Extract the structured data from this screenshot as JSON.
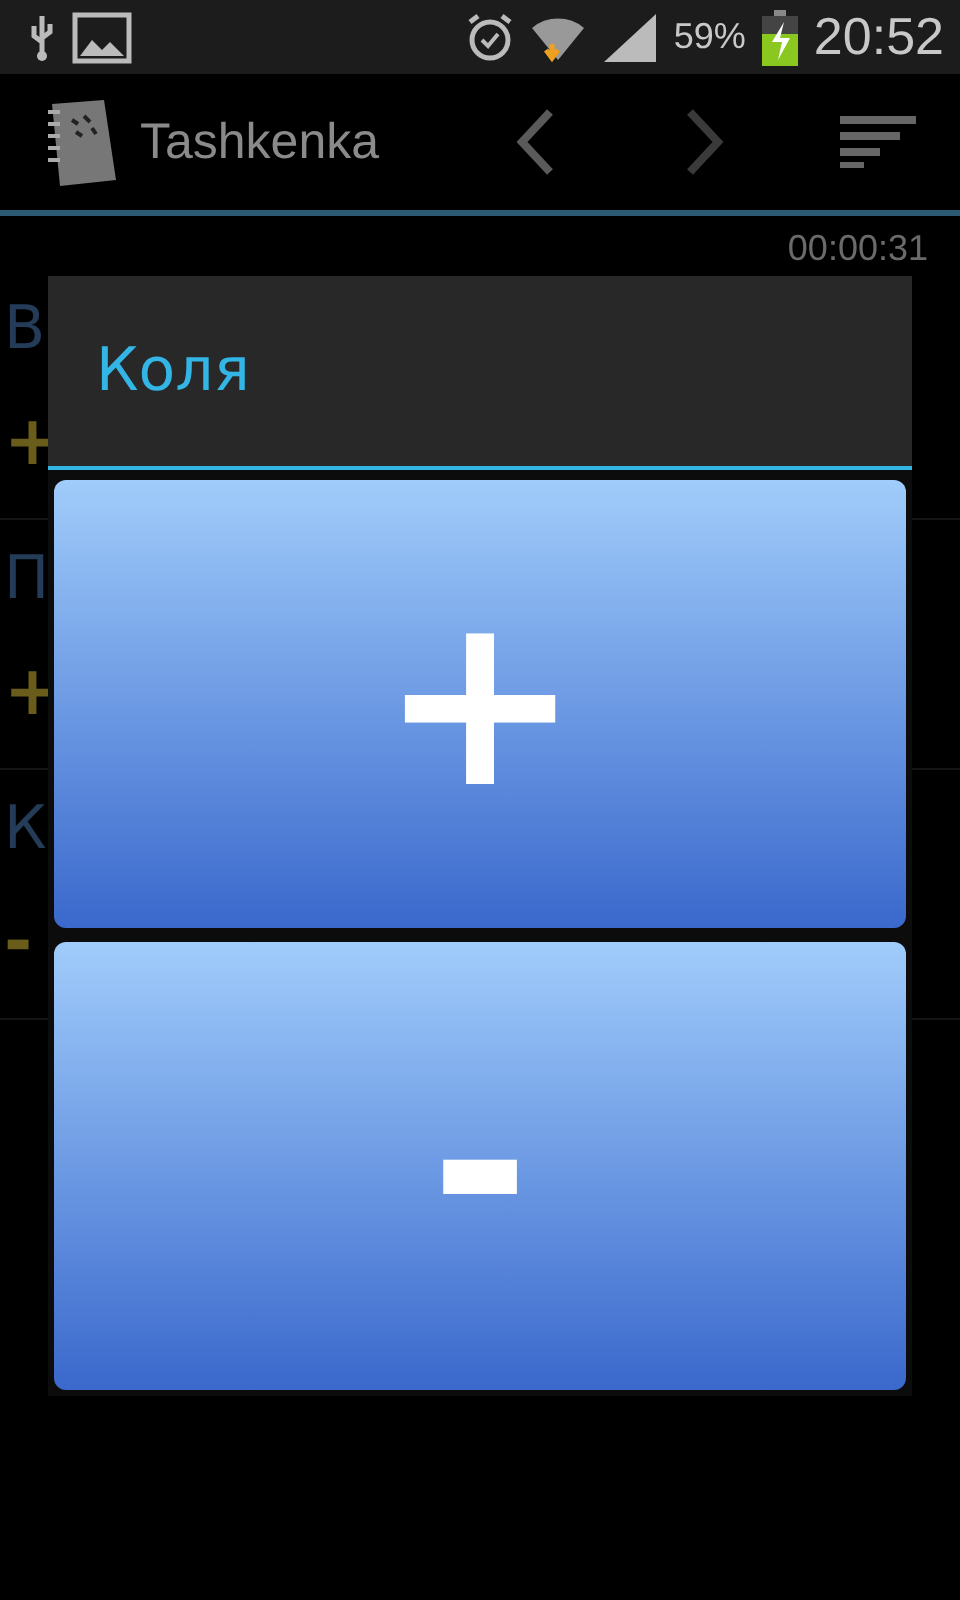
{
  "status_bar": {
    "battery_text": "59%",
    "time": "20:52"
  },
  "action_bar": {
    "title": "Tashkenka"
  },
  "timer": "00:00:31",
  "list": [
    {
      "name": "В",
      "sign": "+"
    },
    {
      "name": "П",
      "sign": "+"
    },
    {
      "name": "К",
      "sign": "-"
    }
  ],
  "dialog": {
    "title": "Коля",
    "buttons": [
      "+",
      "-"
    ]
  }
}
